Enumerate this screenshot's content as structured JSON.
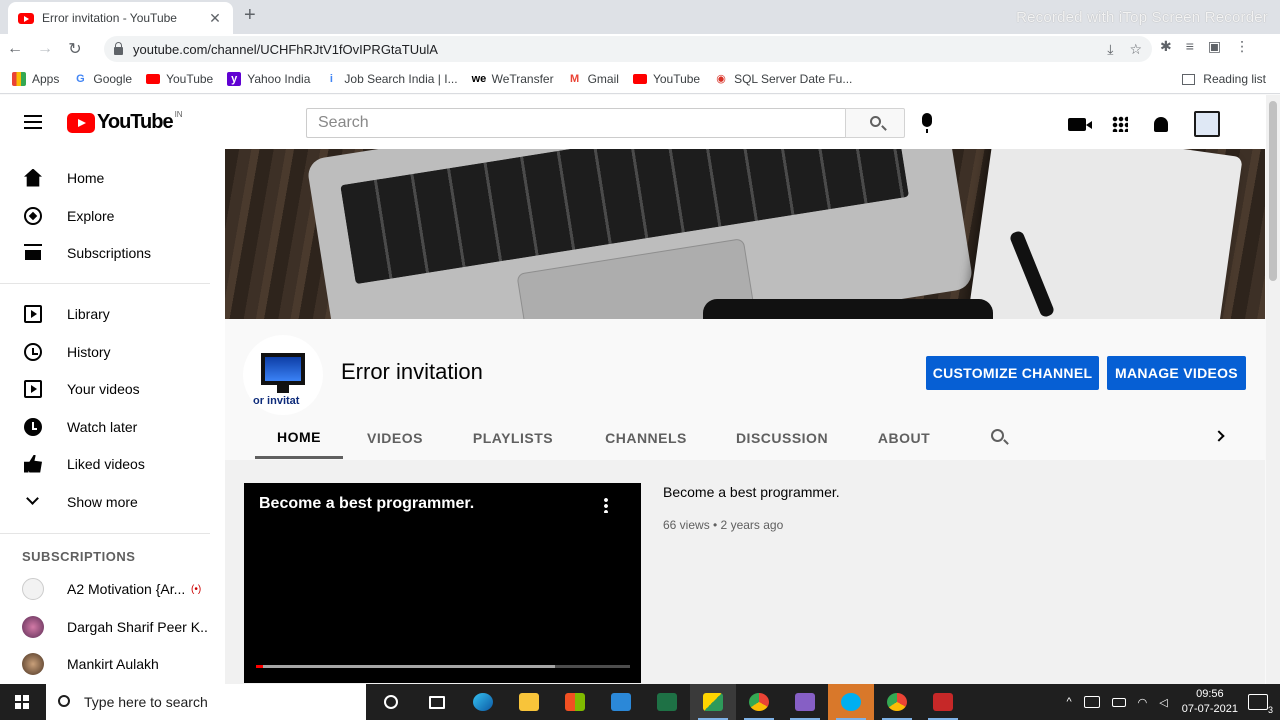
{
  "browser": {
    "tab_title": "Error invitation - YouTube",
    "tab_close": "✕",
    "new_tab": "+",
    "watermark": "Recorded with iTop Screen Recorder",
    "url": "youtube.com/channel/UCHFhRJtV1fOvIPRGtaTUulA",
    "bookmarks": [
      {
        "label": "Apps",
        "icon": "apps-icon"
      },
      {
        "label": "Google",
        "icon": "google-icon"
      },
      {
        "label": "YouTube",
        "icon": "youtube-icon"
      },
      {
        "label": "Yahoo India",
        "icon": "yahoo-icon"
      },
      {
        "label": "Job Search India | I...",
        "icon": "indeed-icon"
      },
      {
        "label": "WeTransfer",
        "icon": "wetransfer-icon"
      },
      {
        "label": "Gmail",
        "icon": "gmail-icon"
      },
      {
        "label": "YouTube",
        "icon": "youtube-icon"
      },
      {
        "label": "SQL Server Date Fu...",
        "icon": "sql-icon"
      }
    ],
    "reading_list": "Reading list"
  },
  "masthead": {
    "logo_text": "YouTube",
    "logo_region": "IN",
    "search_placeholder": "Search"
  },
  "sidebar": {
    "primary": [
      {
        "label": "Home",
        "icon": "home-icon"
      },
      {
        "label": "Explore",
        "icon": "explore-icon"
      },
      {
        "label": "Subscriptions",
        "icon": "subscriptions-icon"
      }
    ],
    "secondary": [
      {
        "label": "Library",
        "icon": "library-icon"
      },
      {
        "label": "History",
        "icon": "history-icon"
      },
      {
        "label": "Your videos",
        "icon": "your-videos-icon"
      },
      {
        "label": "Watch later",
        "icon": "watch-later-icon"
      },
      {
        "label": "Liked videos",
        "icon": "liked-videos-icon"
      },
      {
        "label": "Show more",
        "icon": "chevron-down-icon"
      }
    ],
    "subscriptions_header": "SUBSCRIPTIONS",
    "subscriptions": [
      {
        "name": "A2 Motivation {Ar...",
        "live": "(•)",
        "avatar_color": "#f2f2f2"
      },
      {
        "name": "Dargah Sharif Peer K...",
        "avatar_color": "#8a4f7d"
      },
      {
        "name": "Mankirt Aulakh",
        "avatar_color": "#7a5a3c"
      }
    ]
  },
  "channel": {
    "name": "Error invitation",
    "avatar_text": "or invitat",
    "customize_button": "CUSTOMIZE CHANNEL",
    "manage_button": "MANAGE VIDEOS",
    "tabs": [
      "HOME",
      "VIDEOS",
      "PLAYLISTS",
      "CHANNELS",
      "DISCUSSION",
      "ABOUT"
    ],
    "active_tab": "HOME"
  },
  "featured_video": {
    "player_title": "Become a best programmer.",
    "title": "Become a best programmer.",
    "meta": "66 views • 2 years ago",
    "buffered_fraction": 0.8,
    "played_fraction": 0.02
  },
  "taskbar": {
    "search_placeholder": "Type here to search",
    "time": "09:56",
    "date": "07-07-2021",
    "notification_count": "3"
  },
  "colors": {
    "accent_blue": "#065fd4",
    "youtube_red": "#ff0000"
  }
}
